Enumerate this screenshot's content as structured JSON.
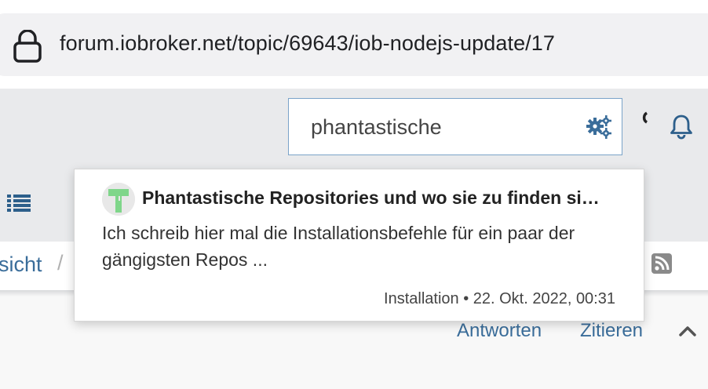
{
  "browser": {
    "url": "forum.iobroker.net/topic/69643/iob-nodejs-update/17",
    "lock_icon": "lock-icon"
  },
  "header": {
    "search_value": "phantastische",
    "search_settings_icon": "gears-icon",
    "notifications_icon": "bell-icon",
    "menu_icon": "list-icon",
    "accent_color": "#3a6d9a"
  },
  "breadcrumb": {
    "item": "sicht",
    "separator": "/"
  },
  "search_results": [
    {
      "title": "Phantastische Repositories und wo sie zu finden si…",
      "snippet": "Ich schreib hier mal die Installationsbefehle für ein paar der gängigsten Repos ...",
      "meta": "Installation • 22. Okt. 2022, 00:31"
    }
  ],
  "post_actions": {
    "reply_label": "Antworten",
    "quote_label": "Zitieren"
  }
}
